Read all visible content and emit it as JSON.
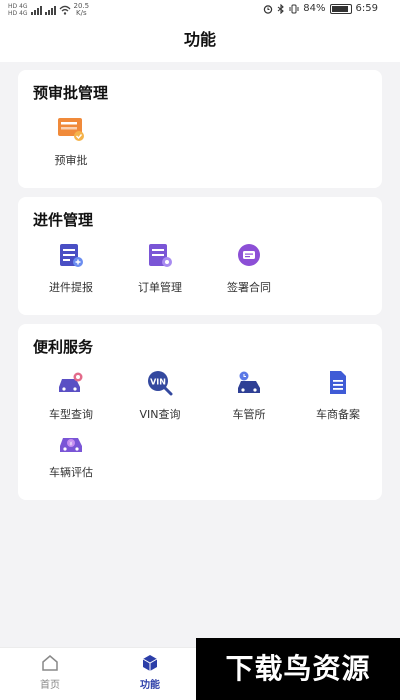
{
  "status_bar": {
    "net_left_1": "HD",
    "net_type_1": "4G",
    "net_left_2": "HD",
    "net_type_2": "4G",
    "speed_value": "20.5",
    "speed_unit": "K/s",
    "battery": "84%",
    "time": "6:59"
  },
  "header": {
    "title": "功能"
  },
  "sections": [
    {
      "title": "预审批管理",
      "items": [
        {
          "label": "预审批",
          "icon": "approval-card-icon"
        }
      ]
    },
    {
      "title": "进件管理",
      "items": [
        {
          "label": "进件提报",
          "icon": "document-submit-icon"
        },
        {
          "label": "订单管理",
          "icon": "order-manage-icon"
        },
        {
          "label": "签署合同",
          "icon": "sign-contract-icon"
        }
      ]
    },
    {
      "title": "便利服务",
      "items": [
        {
          "label": "车型查询",
          "icon": "car-search-icon"
        },
        {
          "label": "VIN查询",
          "icon": "vin-search-icon"
        },
        {
          "label": "车管所",
          "icon": "vehicle-office-icon"
        },
        {
          "label": "车商备案",
          "icon": "dealer-filing-icon"
        },
        {
          "label": "车辆评估",
          "icon": "vehicle-valuation-icon"
        }
      ]
    }
  ],
  "tab_bar": {
    "tabs": [
      {
        "label": "首页",
        "active": false
      },
      {
        "label": "功能",
        "active": true
      }
    ],
    "active_color": "#2c3ea8"
  },
  "watermark": {
    "text": "下载鸟资源"
  },
  "colors": {
    "orange": "#f08a3a",
    "purple": "#7a55d6",
    "navy": "#34499f",
    "blue": "#3f5bd6"
  }
}
